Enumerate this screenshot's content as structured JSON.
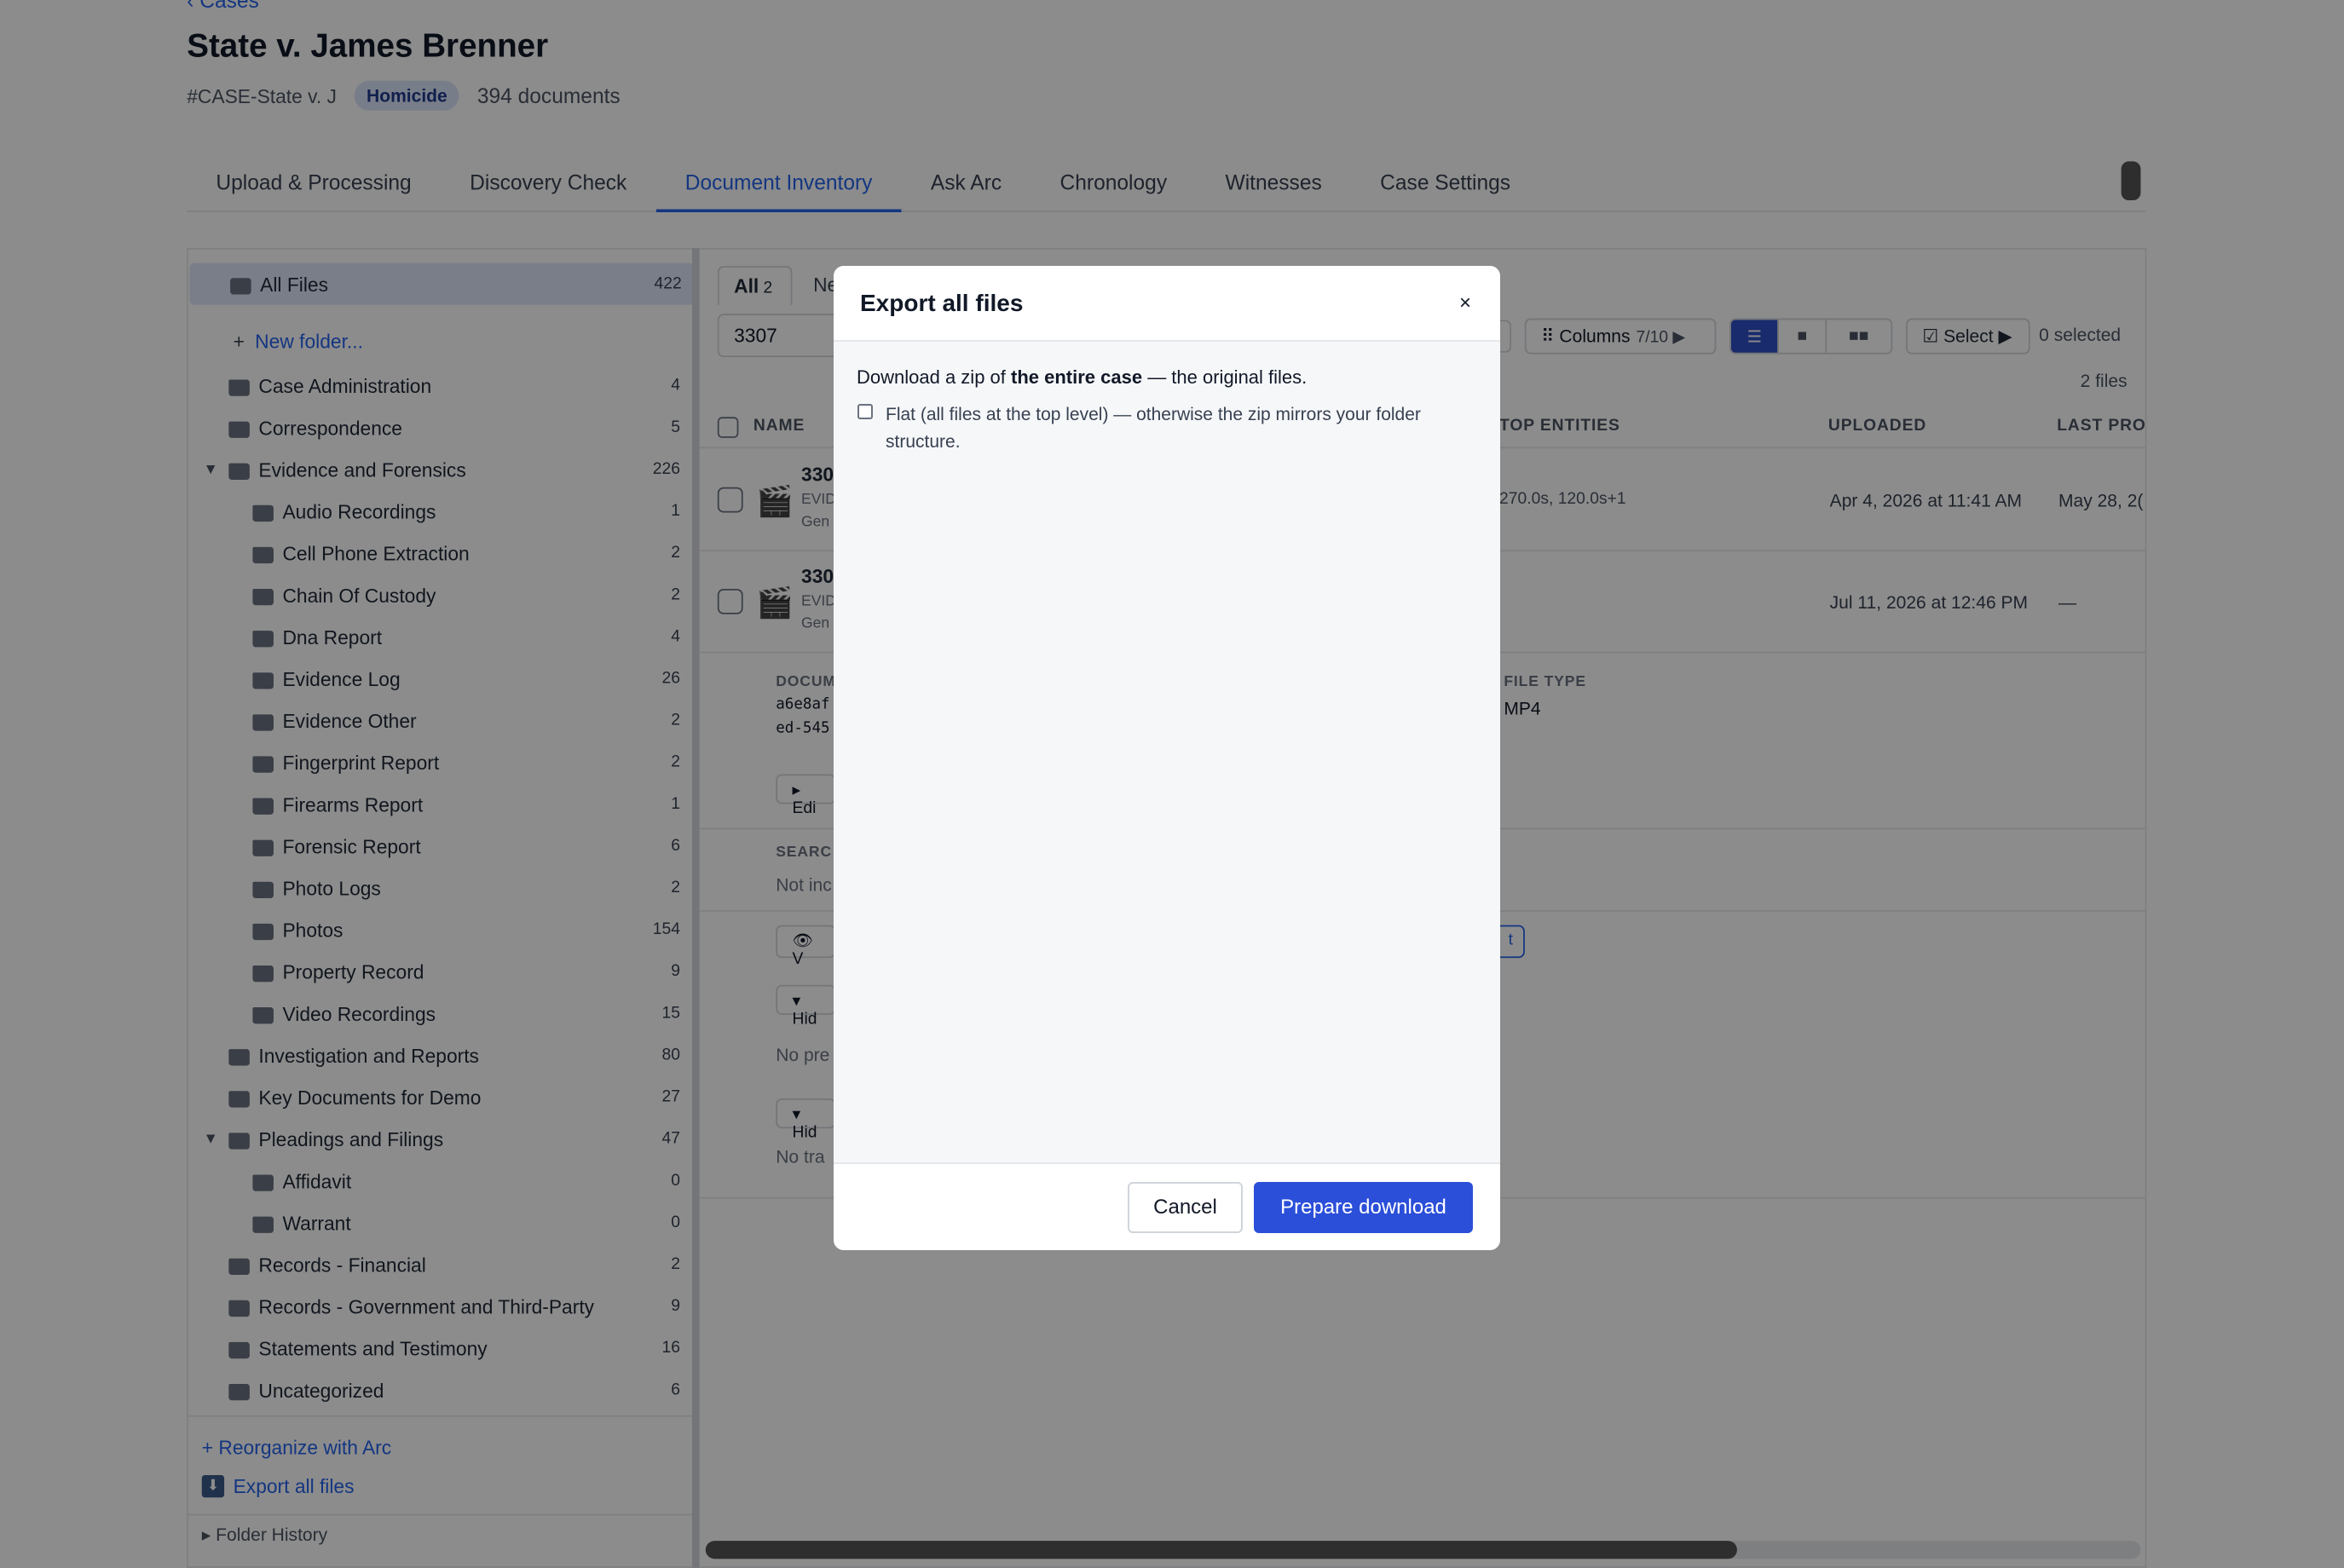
{
  "header": {
    "back_label": "‹ Cases",
    "title": "State v. James Brenner",
    "case_id": "#CASE-State v. J",
    "badge": "Homicide",
    "documents": "394 documents"
  },
  "tabs": [
    {
      "label": "Upload & Processing"
    },
    {
      "label": "Discovery Check"
    },
    {
      "label": "Document Inventory"
    },
    {
      "label": "Ask Arc"
    },
    {
      "label": "Chronology"
    },
    {
      "label": "Witnesses"
    },
    {
      "label": "Case Settings"
    }
  ],
  "sidebar": {
    "all_files": {
      "label": "All Files",
      "count": "422"
    },
    "new_folder": "New folder...",
    "folders": [
      {
        "label": "Case Administration",
        "count": "4"
      },
      {
        "label": "Correspondence",
        "count": "5"
      },
      {
        "label": "Evidence and Forensics",
        "count": "226"
      },
      {
        "label": "Audio Recordings",
        "count": "1"
      },
      {
        "label": "Cell Phone Extraction",
        "count": "2"
      },
      {
        "label": "Chain Of Custody",
        "count": "2"
      },
      {
        "label": "Dna Report",
        "count": "4"
      },
      {
        "label": "Evidence Log",
        "count": "26"
      },
      {
        "label": "Evidence Other",
        "count": "2"
      },
      {
        "label": "Fingerprint Report",
        "count": "2"
      },
      {
        "label": "Firearms Report",
        "count": "1"
      },
      {
        "label": "Forensic Report",
        "count": "6"
      },
      {
        "label": "Photo Logs",
        "count": "2"
      },
      {
        "label": "Photos",
        "count": "154"
      },
      {
        "label": "Property Record",
        "count": "9"
      },
      {
        "label": "Video Recordings",
        "count": "15"
      },
      {
        "label": "Investigation and Reports",
        "count": "80"
      },
      {
        "label": "Key Documents for Demo",
        "count": "27"
      },
      {
        "label": "Pleadings and Filings",
        "count": "47"
      },
      {
        "label": "Affidavit",
        "count": "0"
      },
      {
        "label": "Warrant",
        "count": "0"
      },
      {
        "label": "Records - Financial",
        "count": "2"
      },
      {
        "label": "Records - Government and Third-Party",
        "count": "9"
      },
      {
        "label": "Statements and Testimony",
        "count": "16"
      },
      {
        "label": "Uncategorized",
        "count": "6"
      }
    ],
    "reorganize": "+ Reorganize with Arc",
    "export": "Export all files",
    "folder_history": "Folder History"
  },
  "main": {
    "subtab_all": "All",
    "subtab_all_count": "2",
    "subtab_ne": "Ne",
    "search_value": "3307",
    "columns_label": "Columns",
    "columns_count": "7/10 ▶",
    "select_label": "☑ Select ▶",
    "selected": "0 selected",
    "file_count": "2 files",
    "headers": {
      "name": "NAME",
      "top_entities": "TOP ENTITIES",
      "uploaded": "UPLOADED",
      "last_pro": "LAST PRO"
    },
    "rows": [
      {
        "name": "330",
        "sub1": "EVID",
        "sub2": "Gen",
        "entities": "270.0s, 120.0s+1",
        "uploaded": "Apr 4, 2026 at 11:41 AM",
        "last": "May 28, 2("
      },
      {
        "name": "330",
        "sub1": "EVID",
        "sub2": "Gen",
        "entities": "",
        "uploaded": "Jul 11, 2026 at 12:46 PM",
        "last": "—"
      }
    ],
    "detail": {
      "docu_label": "DOCUM",
      "hash1": "a6e8af",
      "hash2": "ed-545",
      "file_type_label": "FILE TYPE",
      "file_type": "MP4",
      "edit_btn": "▸ Edi",
      "search_label": "SEARC",
      "not_indexed": "Not inc",
      "view_btn": "👁 V",
      "t_btn": "t",
      "hide1": "▾ Hid",
      "no_preview": "No pre",
      "hide2": "▾ Hid",
      "no_transcript": "No tra"
    }
  },
  "modal": {
    "title": "Export all files",
    "close": "×",
    "desc_pre": "Download a zip of ",
    "desc_bold": "the entire case",
    "desc_post": " — the original files.",
    "checkbox_label": "Flat (all files at the top level) — otherwise the zip mirrors your folder structure.",
    "cancel": "Cancel",
    "prepare": "Prepare download"
  }
}
